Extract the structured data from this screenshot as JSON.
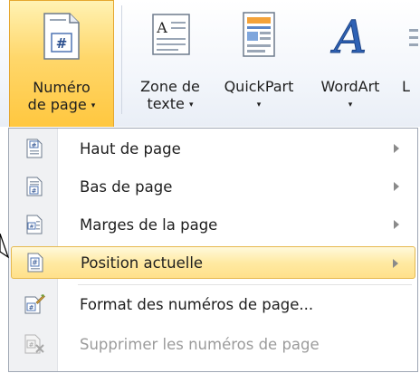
{
  "ribbon": {
    "buttons": [
      {
        "label_line1": "Numéro",
        "label_line2": "de page",
        "has_arrow": true,
        "icon": "page-number-icon",
        "active": true
      },
      {
        "label_line1": "Zone de",
        "label_line2": "texte",
        "has_arrow": true,
        "icon": "text-box-icon"
      },
      {
        "label_line1": "QuickPart",
        "label_line2": "",
        "has_arrow": true,
        "icon": "quickpart-icon"
      },
      {
        "label_line1": "WordArt",
        "label_line2": "",
        "has_arrow": true,
        "icon": "wordart-icon"
      },
      {
        "label_line1": "L",
        "label_line2": "",
        "has_arrow": false,
        "icon": "lettrine-icon"
      }
    ],
    "arrow_glyph": "▾",
    "active_color": "#ffd76b"
  },
  "menu": {
    "items": [
      {
        "label": "Haut de page",
        "accel": "t",
        "icon": "header-page-icon",
        "submenu": true
      },
      {
        "label": "Bas de page",
        "accel": "B",
        "icon": "footer-page-icon",
        "submenu": true
      },
      {
        "label": "Marges de la page",
        "accel": "p",
        "icon": "page-margins-icon",
        "submenu": true
      },
      {
        "label": "Position actuelle",
        "accel": "c",
        "icon": "current-position-icon",
        "submenu": true,
        "highlighted": true
      },
      {
        "label": "Format des numéros de page...",
        "accel": "F",
        "icon": "format-page-numbers-icon",
        "submenu": false
      },
      {
        "label": "Supprimer les numéros de page",
        "accel": "S",
        "icon": "remove-page-numbers-icon",
        "submenu": false,
        "disabled": true
      }
    ],
    "highlight_color": "#ffeaa3"
  }
}
